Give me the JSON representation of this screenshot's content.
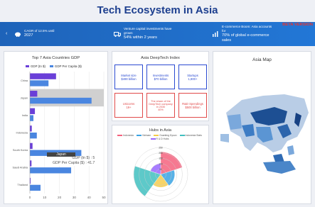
{
  "page": {
    "title": "Tech Ecosystem in Asia"
  },
  "banner": {
    "items": [
      {
        "l1": "CAGR of 12.5% until",
        "l2": "2027",
        "icon": "piggy-bank-icon"
      },
      {
        "l1": "Venture capital investments have",
        "l2": "grown",
        "l3": "54% within 2 years",
        "icon": "truck-icon"
      },
      {
        "l1": "E-commerce Boom: Asia accounts",
        "l2": "for",
        "l3": "70% of global e-commerce",
        "l4": "sales",
        "icon": "bar-chart-icon"
      }
    ],
    "beta": "BETA VERSION",
    "accent": "#2277d6"
  },
  "gdp_panel": {
    "title": "Top 7 Asia Countries GDP",
    "legend": [
      "GDP (tn $)",
      "GDP Per Capita ($)"
    ],
    "tooltip": {
      "title": "Japan",
      "l1": "GDP (tn $) : 5",
      "l2": "GDP Per Capita ($) : 41.7"
    }
  },
  "chart_data": {
    "type": "bar",
    "orientation": "horizontal",
    "categories": [
      "China",
      "Japan",
      "India",
      "Indonesia",
      "South Korea",
      "Saudi Arabia",
      "Thailand"
    ],
    "series": [
      {
        "name": "GDP (tn $)",
        "values": [
          17.7,
          5,
          3.4,
          1.3,
          1.8,
          1.1,
          0.5
        ],
        "color": "#6a3fd8"
      },
      {
        "name": "GDP Per Capita ($)",
        "values": [
          12.6,
          41.7,
          2.4,
          4.7,
          34.8,
          27.9,
          7.2
        ],
        "color": "#4a86e0"
      }
    ],
    "x_ticks": [
      "0",
      "10",
      "20",
      "30",
      "40",
      "50"
    ],
    "xlim": [
      0,
      50
    ],
    "highlight": "Japan"
  },
  "deeptech": {
    "title": "Asia DeepTech Index",
    "boxes": [
      {
        "l1": "Market size",
        "l2": "$490 billion",
        "color": "#2b4bd1"
      },
      {
        "l1": "Investments",
        "l2": "$70 billion",
        "color": "#2b4bd1"
      },
      {
        "l1": "Startups",
        "l2": "1,800+",
        "color": "#2b4bd1"
      },
      {
        "l1": "Unicorns",
        "l2": "19+",
        "color": "#e04a4a"
      },
      {
        "l1": "The share of the",
        "l2": "DeepTech company",
        "l3": "in 2030",
        "l4": "40%",
        "color": "#e04a4a"
      },
      {
        "l1": "R&D Spendings",
        "l2": "$500 billion",
        "color": "#e04a4a"
      }
    ]
  },
  "hubs": {
    "title": "Hubs in Asia",
    "legend": [
      "Indonesia",
      "Vietnam",
      "Guanting Dyson",
      "Indonesia Stats",
      "R & D Hubs"
    ],
    "legend_colors": [
      "#f4627e",
      "#3aa3e3",
      "#f6cc4c",
      "#41c0c0",
      "#9966ff"
    ],
    "ticks": [
      "250",
      "200",
      "150",
      "100",
      "50"
    ],
    "values": [
      210,
      130,
      120,
      250,
      100
    ],
    "rmax": 250
  },
  "map": {
    "title": "Asia Map"
  }
}
